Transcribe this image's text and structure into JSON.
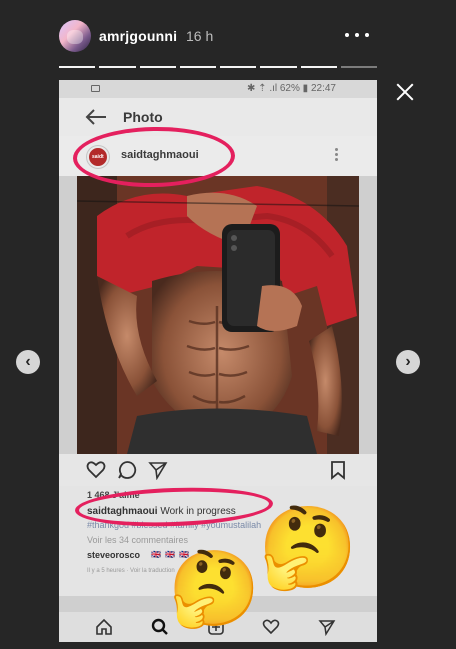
{
  "story": {
    "username": "amrjgounni",
    "time": "16 h",
    "progress_segments_total": 8,
    "progress_segments_viewed": 7
  },
  "phone": {
    "status_info": "✱ ⇡ .ıl 62% ▮ 22:47",
    "title": "Photo",
    "avatar_text": "saidt",
    "post_username": "saidtaghmaoui",
    "likes": "1 468 J'aime",
    "caption_user": "saidtaghmaoui",
    "caption_text": "Work in progress",
    "hashtags": "#thankgod #blessed #family #youmustalilah",
    "view_comments": "Voir les 34 commentaires",
    "commenter": "steveorosco",
    "flags": "🇬🇧 🇬🇧 🇬🇧",
    "time_ago": "Il y a 5 heures · Voir la traduction"
  },
  "emojis": {
    "thinking": "🤔"
  },
  "colors": {
    "background": "#262626",
    "highlight": "#e4205e"
  }
}
